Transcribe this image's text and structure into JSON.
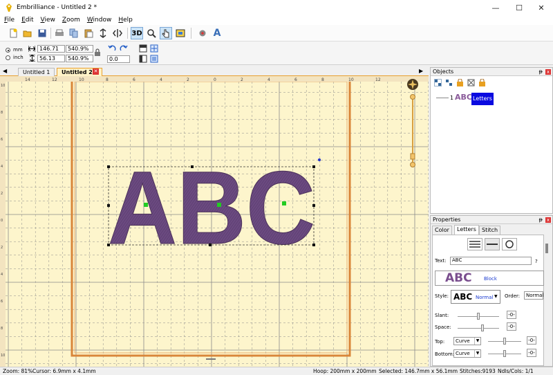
{
  "window": {
    "title": "Embrilliance -  Untitled 2 *",
    "minimize_glyph": "—",
    "maximize_glyph": "☐",
    "close_glyph": "✕"
  },
  "menu": {
    "items": [
      {
        "label": "File"
      },
      {
        "label": "Edit"
      },
      {
        "label": "View"
      },
      {
        "label": "Zoom"
      },
      {
        "label": "Window"
      },
      {
        "label": "Help"
      }
    ]
  },
  "toolbar": {
    "three_d_label": "3D",
    "font_label": "A"
  },
  "sizebar": {
    "unit_mm": "mm",
    "unit_inch": "inch",
    "width_value": "146.71",
    "height_value": "56.13",
    "width_percent": "540.9%",
    "height_percent": "540.9%",
    "rotation_value": "0.0"
  },
  "tabs": [
    {
      "label": "Untitled 1"
    },
    {
      "label": "Untitled 2 *"
    }
  ],
  "canvas": {
    "design_text": "ABC",
    "hruler_labels": [
      "14",
      "12",
      "10",
      "8",
      "6",
      "4",
      "2",
      "0",
      "2",
      "4",
      "6",
      "8",
      "10",
      "12"
    ],
    "vruler_labels": [
      "10",
      "8",
      "6",
      "4",
      "2",
      "0",
      "2",
      "4",
      "6",
      "8",
      "10"
    ],
    "colors": {
      "grid_bg": "#fdf5cc",
      "grid_line": "#8a8a8a",
      "hoop": "#d9863a",
      "thread": "#6b4a80",
      "handle_green": "#22cc22",
      "ruler_bg": "#f3e4c0"
    }
  },
  "objects_panel": {
    "title": "Objects",
    "item_prefix": "1",
    "item_thumb": "ABC",
    "item_label": "Letters"
  },
  "properties_panel": {
    "title": "Properties",
    "tabs": [
      {
        "label": "Color"
      },
      {
        "label": "Letters"
      },
      {
        "label": "Stitch"
      }
    ],
    "text_label": "Text:",
    "text_value": "ABC",
    "help_label": "?",
    "font_preview": "ABC",
    "font_name": "Block",
    "style_label": "Style:",
    "style_preview": "ABC",
    "style_value": "Normal",
    "order_label": "Order:",
    "order_value": "Normal",
    "slant_label": "Slant:",
    "space_label": "Space:",
    "top_label": "Top:",
    "top_value": "Curve",
    "bottom_label": "Bottom:",
    "bottom_value": "Curve",
    "reset_label": "-0-",
    "pin_glyph": "ᵽ",
    "close_glyph": "x"
  },
  "statusbar": {
    "zoom": "Zoom: 81%",
    "cursor": "Cursor: 6.9mm x 4.1mm",
    "hoop": "Hoop: 200mm x 200mm",
    "selected": "Selected: 146.7mm x 56.1mm",
    "stitches": "Stitches:9193",
    "ndls": "Ndls/Cols: 1/1"
  }
}
